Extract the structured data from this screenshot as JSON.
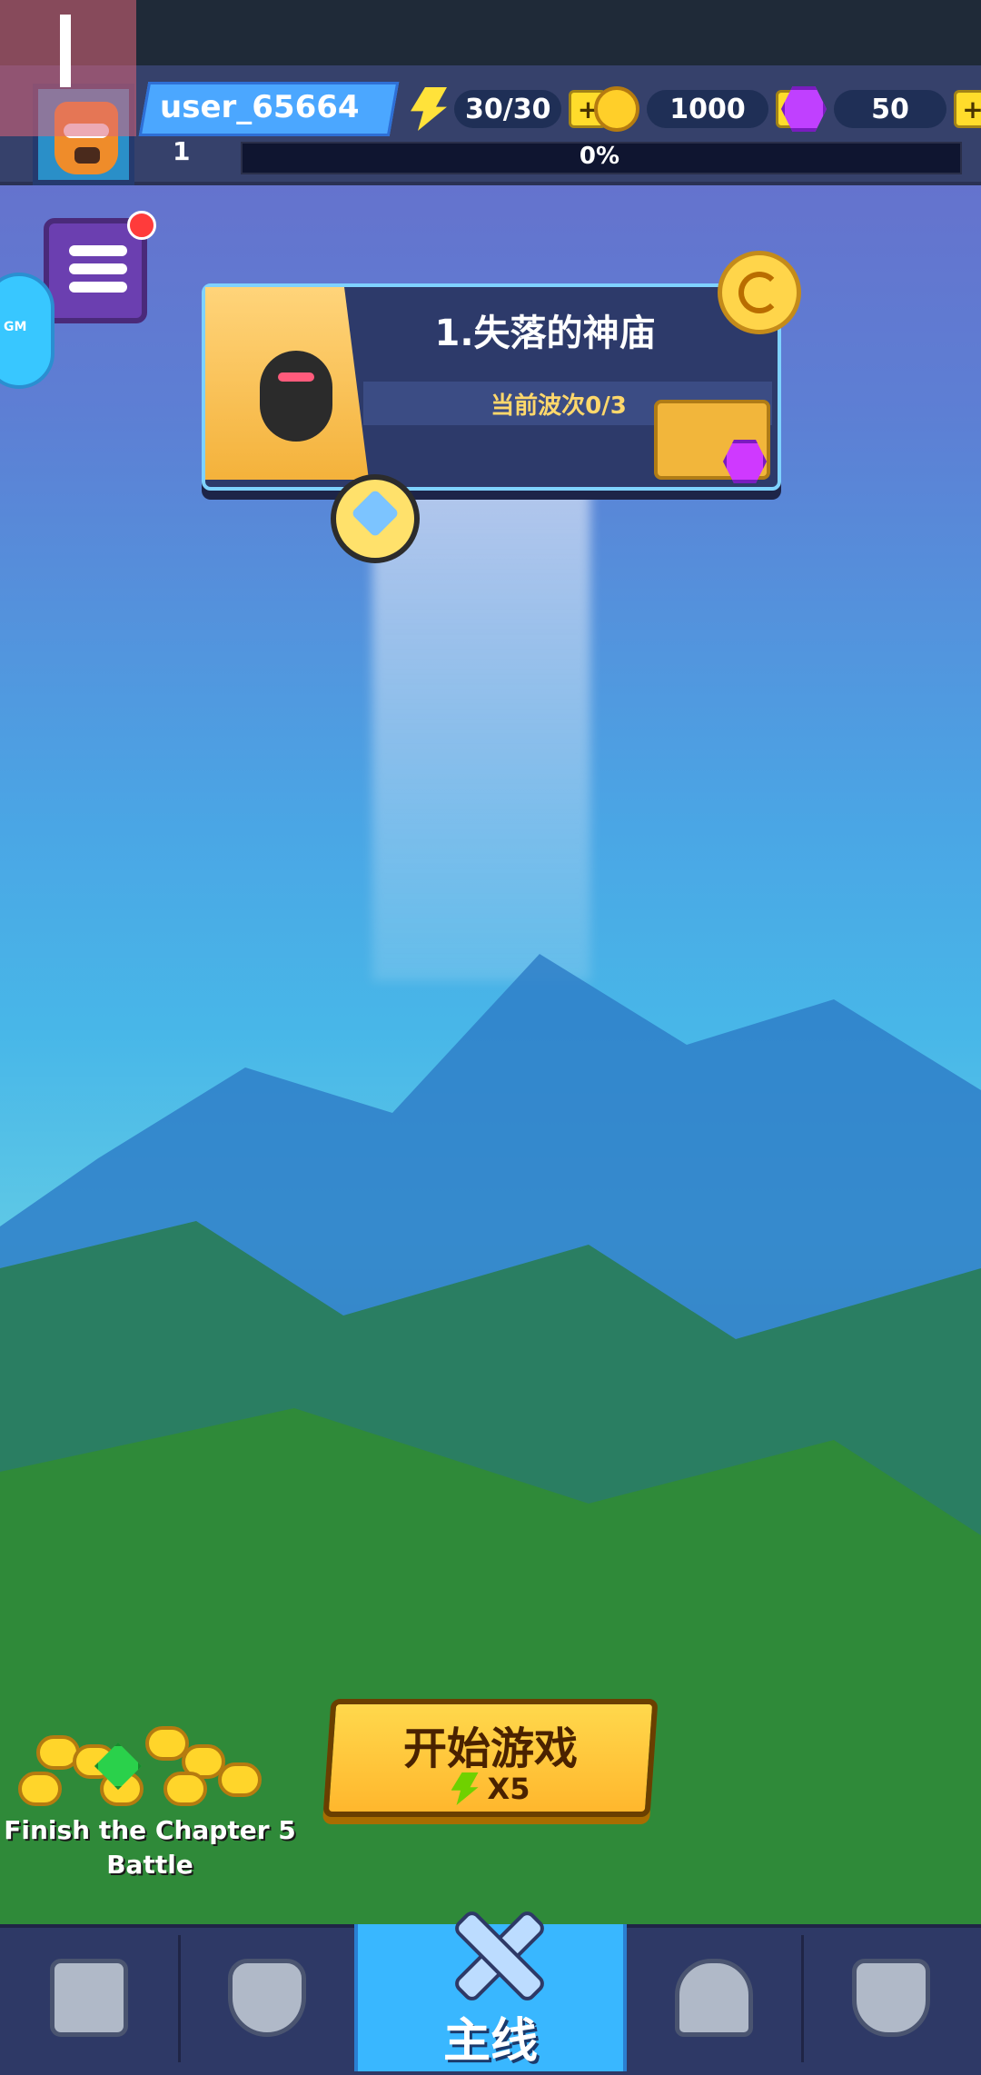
{
  "profile": {
    "username": "user_65664",
    "level": "1",
    "xp_percent_label": "0%",
    "xp_progress": 0
  },
  "resources": {
    "energy": "30/30",
    "coins": "1000",
    "gems": "50",
    "plus_label": "+"
  },
  "menu": {
    "gm_label": "GM"
  },
  "chapter": {
    "title": "1.失落的神庙",
    "wave_text": "当前波次0/3"
  },
  "start_button": {
    "label": "开始游戏",
    "cost_label": "X5"
  },
  "reward": {
    "text": "Finish the Chapter 5 Battle"
  },
  "bottom_nav": {
    "active_label": "主线",
    "items": [
      {
        "icon": "chest-icon"
      },
      {
        "icon": "shield-icon"
      },
      {
        "icon": "crossed-swords-icon"
      },
      {
        "icon": "dungeon-gate-icon"
      },
      {
        "icon": "trophy-icon"
      }
    ]
  },
  "colors": {
    "accent_yellow": "#ffd84c",
    "nav_active": "#39b7ff",
    "topbar": "#36416b"
  }
}
